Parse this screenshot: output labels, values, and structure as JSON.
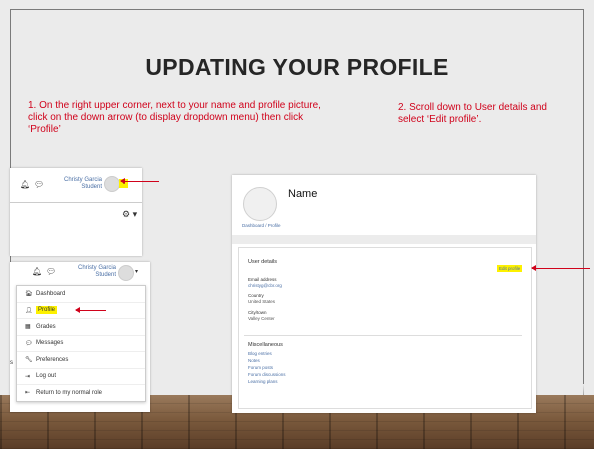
{
  "slide": {
    "title": "UPDATING YOUR PROFILE",
    "step1": "1. On the right upper corner, next to your name and profile picture, click on the down arrow (to display dropdown menu) then click ‘Profile’",
    "step2": "2. Scroll down to User details and select ‘Edit profile’."
  },
  "shot_a": {
    "user_name": "Christy Garcia",
    "user_role": "Student",
    "caret": "▾",
    "gear": "⚙ ▾"
  },
  "shot_b": {
    "user_name": "Christy Garcia",
    "user_role": "Student",
    "menu_items": [
      {
        "label": "Dashboard",
        "icon": "dashboard-icon",
        "glyph": "🏠︎"
      },
      {
        "label": "Profile",
        "icon": "user-icon",
        "glyph": "👤︎"
      },
      {
        "label": "Grades",
        "icon": "table-icon",
        "glyph": "▦"
      },
      {
        "label": "Messages",
        "icon": "chat-icon",
        "glyph": "💬︎"
      },
      {
        "label": "Preferences",
        "icon": "wrench-icon",
        "glyph": "🔧︎"
      },
      {
        "label": "Log out",
        "icon": "logout-icon",
        "glyph": "⇥"
      },
      {
        "label": "Return to my normal role",
        "icon": "return-icon",
        "glyph": "⇤"
      }
    ],
    "side_char": "s"
  },
  "shot_c": {
    "name": "Name",
    "breadcrumb": "Dashboard / Profile",
    "user_details": "User details",
    "edit_profile": "Edit profile",
    "email_label": "Email address",
    "email_value": "christyg@cbr.org",
    "country_label": "Country",
    "country_value": "United States",
    "city_label": "City/town",
    "city_value": "Valley Center",
    "misc": "Miscellaneous",
    "misc_links": [
      "Blog entries",
      "Notes",
      "Forum posts",
      "Forum discussions",
      "Learning plans"
    ]
  },
  "colors": {
    "accent_text": "#d0021b",
    "highlight": "#fdf100",
    "link": "#4a6fa5"
  }
}
